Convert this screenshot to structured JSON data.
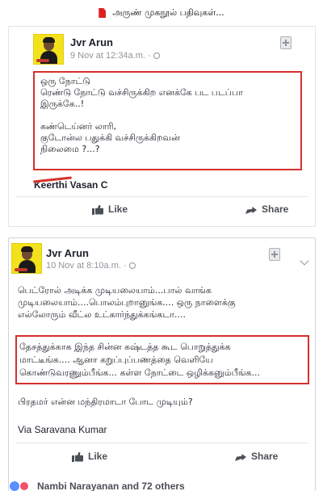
{
  "header": {
    "title": "அருண் முகநூல் பதிவுகள்...",
    "icon": "file-icon",
    "icon_color": "#e02020"
  },
  "posts": [
    {
      "author": "Jvr Arun",
      "date": "9 Nov at 12:34a.m.",
      "visibility_icon": "globe-icon",
      "highlight_color": "#d6312c",
      "lines": [
        "ஒரு நோட்டு",
        "ரெண்டு நோட்டு வச்சிருக்கிற எனக்கே பட படப்பா",
        "இருக்கே..!",
        "",
        "கண்டெய்னர் லாரி,",
        "குடோன்ல பதுக்கி வச்சிருக்கிறவன்",
        "நிலைமை ?...?"
      ],
      "commenter": "Keerthi Vasan C",
      "actions": {
        "like": "Like",
        "share": "Share"
      }
    },
    {
      "author": "Jvr Arun",
      "date": "10 Nov at 8:10a.m.",
      "visibility_icon": "globe-icon",
      "paragraph1": [
        "பெட்ரோல் அடிக்க முடியலையாம்...பால் வாங்க",
        "முடியலையாம்....பொலம்புறானுங்க.... ஒரு நாளைக்கு",
        "எல்லோரும் வீட்ல உட்கார்ந்துக்கங்கடா...."
      ],
      "paragraph2_highlighted": [
        "தேசத்துக்காக இந்த சின்ன கஷ்டத்த கூட பொறுத்துக்க",
        "மாட்டீங்க.... ஆனா கறுப்புப்பணத்தை வெளியே",
        "கொண்டுவரணும்பீங்க... கள்ள நோட்டை ஒழிக்கனும்பீங்க..."
      ],
      "paragraph3": "பிரதமர் என்ன மந்திரமாடா போட முடியும்?",
      "via": "Via Saravana Kumar",
      "actions": {
        "like": "Like",
        "share": "Share"
      },
      "reactions": {
        "label": "Nambi Narayanan and 72 others",
        "like_color": "#5890ff",
        "love_color": "#f25268"
      }
    }
  ]
}
